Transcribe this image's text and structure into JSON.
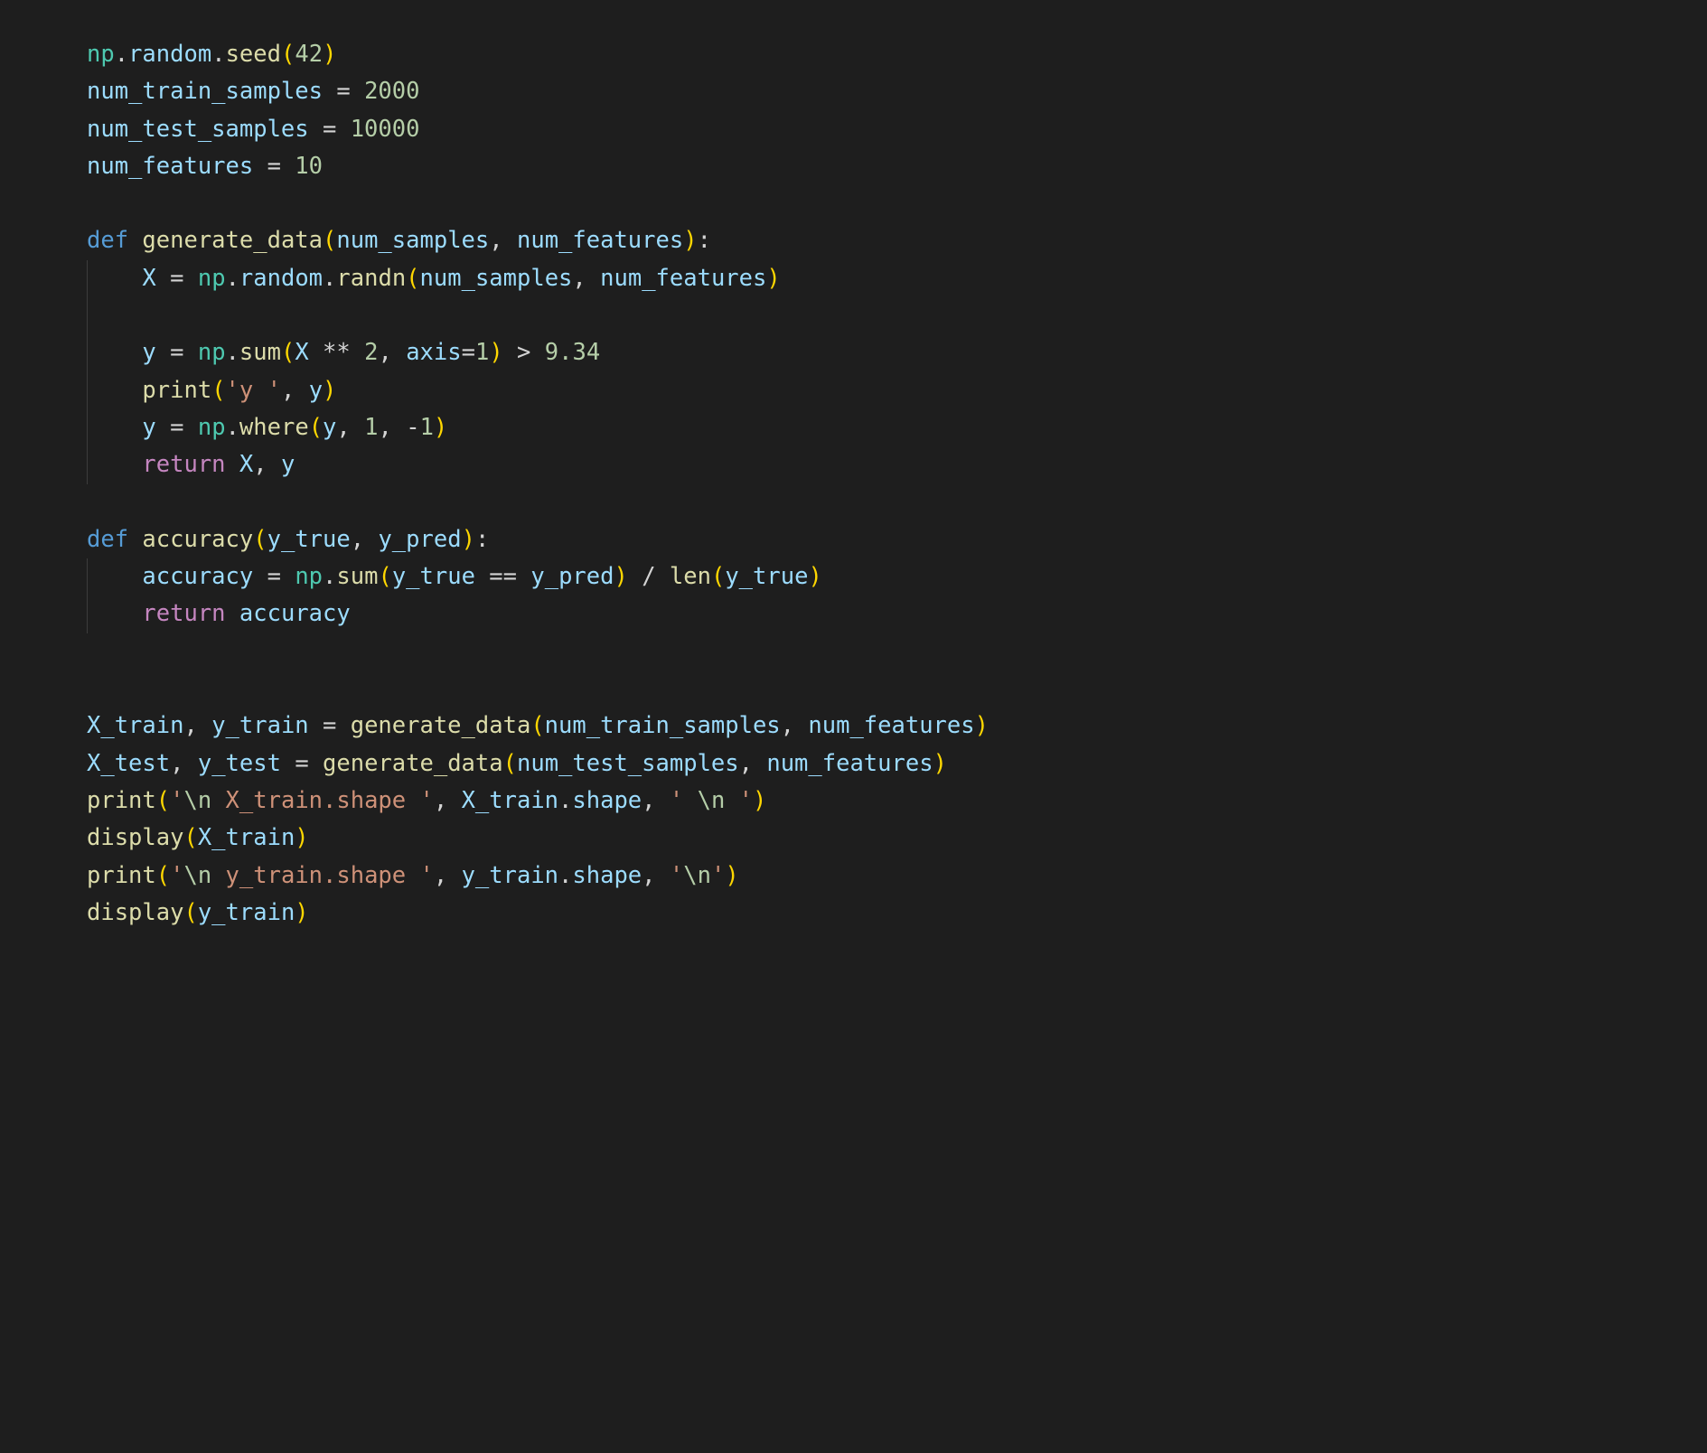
{
  "colors": {
    "bg": "#1e1e1e",
    "default": "#d4d4d4",
    "class": "#4ec9b0",
    "property": "#9cdcfe",
    "function": "#dcdcaa",
    "number": "#b5cea8",
    "keyword": "#569cd6",
    "string": "#ce9178",
    "control": "#c586c0",
    "bracket1": "#ffd700",
    "bracket2": "#da70d6",
    "bracket3": "#179fff"
  },
  "code": {
    "lines": [
      {
        "indent": 0,
        "tokens": [
          {
            "t": "np",
            "c": "var"
          },
          {
            "t": ".",
            "c": "default"
          },
          {
            "t": "random",
            "c": "prop"
          },
          {
            "t": ".",
            "c": "default"
          },
          {
            "t": "seed",
            "c": "func"
          },
          {
            "t": "(",
            "c": "paren"
          },
          {
            "t": "42",
            "c": "num"
          },
          {
            "t": ")",
            "c": "paren"
          }
        ]
      },
      {
        "indent": 0,
        "tokens": [
          {
            "t": "num_train_samples",
            "c": "prop"
          },
          {
            "t": " = ",
            "c": "default"
          },
          {
            "t": "2000",
            "c": "num"
          }
        ]
      },
      {
        "indent": 0,
        "tokens": [
          {
            "t": "num_test_samples",
            "c": "prop"
          },
          {
            "t": " = ",
            "c": "default"
          },
          {
            "t": "10000",
            "c": "num"
          }
        ]
      },
      {
        "indent": 0,
        "tokens": [
          {
            "t": "num_features",
            "c": "prop"
          },
          {
            "t": " = ",
            "c": "default"
          },
          {
            "t": "10",
            "c": "num"
          }
        ]
      },
      {
        "indent": 0,
        "blank": true,
        "tokens": []
      },
      {
        "indent": 0,
        "tokens": [
          {
            "t": "def",
            "c": "kw"
          },
          {
            "t": " ",
            "c": "default"
          },
          {
            "t": "generate_data",
            "c": "fname"
          },
          {
            "t": "(",
            "c": "paren"
          },
          {
            "t": "num_samples",
            "c": "param"
          },
          {
            "t": ", ",
            "c": "default"
          },
          {
            "t": "num_features",
            "c": "param"
          },
          {
            "t": ")",
            "c": "paren"
          },
          {
            "t": ":",
            "c": "default"
          }
        ]
      },
      {
        "indent": 1,
        "tokens": [
          {
            "t": "X",
            "c": "prop"
          },
          {
            "t": " = ",
            "c": "default"
          },
          {
            "t": "np",
            "c": "var"
          },
          {
            "t": ".",
            "c": "default"
          },
          {
            "t": "random",
            "c": "prop"
          },
          {
            "t": ".",
            "c": "default"
          },
          {
            "t": "randn",
            "c": "func"
          },
          {
            "t": "(",
            "c": "paren"
          },
          {
            "t": "num_samples",
            "c": "prop"
          },
          {
            "t": ", ",
            "c": "default"
          },
          {
            "t": "num_features",
            "c": "prop"
          },
          {
            "t": ")",
            "c": "paren"
          }
        ]
      },
      {
        "indent": 1,
        "blank": true,
        "tokens": []
      },
      {
        "indent": 1,
        "tokens": [
          {
            "t": "y",
            "c": "prop"
          },
          {
            "t": " = ",
            "c": "default"
          },
          {
            "t": "np",
            "c": "var"
          },
          {
            "t": ".",
            "c": "default"
          },
          {
            "t": "sum",
            "c": "func"
          },
          {
            "t": "(",
            "c": "paren"
          },
          {
            "t": "X",
            "c": "prop"
          },
          {
            "t": " ** ",
            "c": "default"
          },
          {
            "t": "2",
            "c": "num"
          },
          {
            "t": ", ",
            "c": "default"
          },
          {
            "t": "axis",
            "c": "param"
          },
          {
            "t": "=",
            "c": "default"
          },
          {
            "t": "1",
            "c": "num"
          },
          {
            "t": ")",
            "c": "paren"
          },
          {
            "t": " > ",
            "c": "default"
          },
          {
            "t": "9.34",
            "c": "num"
          }
        ]
      },
      {
        "indent": 1,
        "tokens": [
          {
            "t": "print",
            "c": "func"
          },
          {
            "t": "(",
            "c": "paren"
          },
          {
            "t": "'y '",
            "c": "str"
          },
          {
            "t": ", ",
            "c": "default"
          },
          {
            "t": "y",
            "c": "prop"
          },
          {
            "t": ")",
            "c": "paren"
          }
        ]
      },
      {
        "indent": 1,
        "tokens": [
          {
            "t": "y",
            "c": "prop"
          },
          {
            "t": " = ",
            "c": "default"
          },
          {
            "t": "np",
            "c": "var"
          },
          {
            "t": ".",
            "c": "default"
          },
          {
            "t": "where",
            "c": "func"
          },
          {
            "t": "(",
            "c": "paren"
          },
          {
            "t": "y",
            "c": "prop"
          },
          {
            "t": ", ",
            "c": "default"
          },
          {
            "t": "1",
            "c": "num"
          },
          {
            "t": ", ",
            "c": "default"
          },
          {
            "t": "-",
            "c": "default"
          },
          {
            "t": "1",
            "c": "num"
          },
          {
            "t": ")",
            "c": "paren"
          }
        ]
      },
      {
        "indent": 1,
        "tokens": [
          {
            "t": "return",
            "c": "ret"
          },
          {
            "t": " ",
            "c": "default"
          },
          {
            "t": "X",
            "c": "prop"
          },
          {
            "t": ", ",
            "c": "default"
          },
          {
            "t": "y",
            "c": "prop"
          }
        ]
      },
      {
        "indent": 0,
        "blank": true,
        "tokens": []
      },
      {
        "indent": 0,
        "tokens": [
          {
            "t": "def",
            "c": "kw"
          },
          {
            "t": " ",
            "c": "default"
          },
          {
            "t": "accuracy",
            "c": "fname"
          },
          {
            "t": "(",
            "c": "paren"
          },
          {
            "t": "y_true",
            "c": "param"
          },
          {
            "t": ", ",
            "c": "default"
          },
          {
            "t": "y_pred",
            "c": "param"
          },
          {
            "t": ")",
            "c": "paren"
          },
          {
            "t": ":",
            "c": "default"
          }
        ]
      },
      {
        "indent": 1,
        "tokens": [
          {
            "t": "accuracy",
            "c": "prop"
          },
          {
            "t": " = ",
            "c": "default"
          },
          {
            "t": "np",
            "c": "var"
          },
          {
            "t": ".",
            "c": "default"
          },
          {
            "t": "sum",
            "c": "func"
          },
          {
            "t": "(",
            "c": "paren"
          },
          {
            "t": "y_true",
            "c": "prop"
          },
          {
            "t": " == ",
            "c": "default"
          },
          {
            "t": "y_pred",
            "c": "prop"
          },
          {
            "t": ")",
            "c": "paren"
          },
          {
            "t": " / ",
            "c": "default"
          },
          {
            "t": "len",
            "c": "func"
          },
          {
            "t": "(",
            "c": "paren"
          },
          {
            "t": "y_true",
            "c": "prop"
          },
          {
            "t": ")",
            "c": "paren"
          }
        ]
      },
      {
        "indent": 1,
        "tokens": [
          {
            "t": "return",
            "c": "ret"
          },
          {
            "t": " ",
            "c": "default"
          },
          {
            "t": "accuracy",
            "c": "prop"
          }
        ]
      },
      {
        "indent": 0,
        "blank": true,
        "tokens": []
      },
      {
        "indent": 0,
        "blank": true,
        "tokens": []
      },
      {
        "indent": 0,
        "tokens": [
          {
            "t": "X_train",
            "c": "prop"
          },
          {
            "t": ", ",
            "c": "default"
          },
          {
            "t": "y_train",
            "c": "prop"
          },
          {
            "t": " = ",
            "c": "default"
          },
          {
            "t": "generate_data",
            "c": "func"
          },
          {
            "t": "(",
            "c": "paren"
          },
          {
            "t": "num_train_samples",
            "c": "prop"
          },
          {
            "t": ", ",
            "c": "default"
          },
          {
            "t": "num_features",
            "c": "prop"
          },
          {
            "t": ")",
            "c": "paren"
          }
        ]
      },
      {
        "indent": 0,
        "tokens": [
          {
            "t": "X_test",
            "c": "prop"
          },
          {
            "t": ", ",
            "c": "default"
          },
          {
            "t": "y_test",
            "c": "prop"
          },
          {
            "t": " = ",
            "c": "default"
          },
          {
            "t": "generate_data",
            "c": "func"
          },
          {
            "t": "(",
            "c": "paren"
          },
          {
            "t": "num_test_samples",
            "c": "prop"
          },
          {
            "t": ", ",
            "c": "default"
          },
          {
            "t": "num_features",
            "c": "prop"
          },
          {
            "t": ")",
            "c": "paren"
          }
        ]
      },
      {
        "indent": 0,
        "tokens": [
          {
            "t": "print",
            "c": "func"
          },
          {
            "t": "(",
            "c": "paren"
          },
          {
            "t": "'",
            "c": "str"
          },
          {
            "t": "\\n",
            "c": "num"
          },
          {
            "t": " X_train.shape '",
            "c": "str"
          },
          {
            "t": ", ",
            "c": "default"
          },
          {
            "t": "X_train",
            "c": "prop"
          },
          {
            "t": ".",
            "c": "default"
          },
          {
            "t": "shape",
            "c": "prop"
          },
          {
            "t": ", ",
            "c": "default"
          },
          {
            "t": "' ",
            "c": "str"
          },
          {
            "t": "\\n",
            "c": "num"
          },
          {
            "t": " '",
            "c": "str"
          },
          {
            "t": ")",
            "c": "paren"
          }
        ]
      },
      {
        "indent": 0,
        "tokens": [
          {
            "t": "display",
            "c": "func"
          },
          {
            "t": "(",
            "c": "paren"
          },
          {
            "t": "X_train",
            "c": "prop"
          },
          {
            "t": ")",
            "c": "paren"
          }
        ]
      },
      {
        "indent": 0,
        "tokens": [
          {
            "t": "print",
            "c": "func"
          },
          {
            "t": "(",
            "c": "paren"
          },
          {
            "t": "'",
            "c": "str"
          },
          {
            "t": "\\n",
            "c": "num"
          },
          {
            "t": " y_train.shape '",
            "c": "str"
          },
          {
            "t": ", ",
            "c": "default"
          },
          {
            "t": "y_train",
            "c": "prop"
          },
          {
            "t": ".",
            "c": "default"
          },
          {
            "t": "shape",
            "c": "prop"
          },
          {
            "t": ", ",
            "c": "default"
          },
          {
            "t": "'",
            "c": "str"
          },
          {
            "t": "\\n",
            "c": "num"
          },
          {
            "t": "'",
            "c": "str"
          },
          {
            "t": ")",
            "c": "paren"
          }
        ]
      },
      {
        "indent": 0,
        "tokens": [
          {
            "t": "display",
            "c": "func"
          },
          {
            "t": "(",
            "c": "paren"
          },
          {
            "t": "y_train",
            "c": "prop"
          },
          {
            "t": ")",
            "c": "paren"
          }
        ]
      }
    ]
  }
}
